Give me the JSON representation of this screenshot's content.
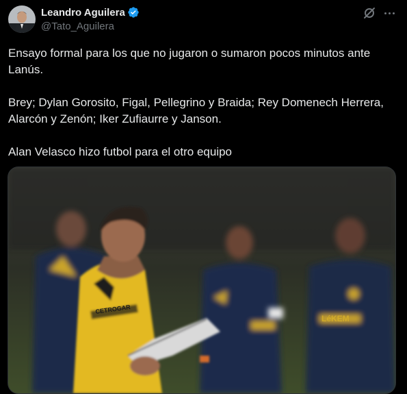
{
  "author": {
    "display_name": "Leandro Aguilera",
    "handle": "@Tato_Aguilera",
    "verified_color": "#1d9bf0"
  },
  "actions": {
    "grok_icon": "grok-icon",
    "more_icon": "more-dots-icon"
  },
  "tweet": {
    "paragraphs": [
      "Ensayo formal para los que no jugaron o sumaron pocos minutos ante Lanús.",
      "Brey; Dylan Gorosito, Figal, Pellegrino y Braida; Rey Domenech Herrera, Alarcón y Zenón; Iker Zufiaurre y Janson.",
      "Alan Velasco hizo futbol para el otro equipo"
    ]
  },
  "media": {
    "shirt_sponsor": "CETROGAR",
    "player_shirt_text": "LéKEM"
  }
}
